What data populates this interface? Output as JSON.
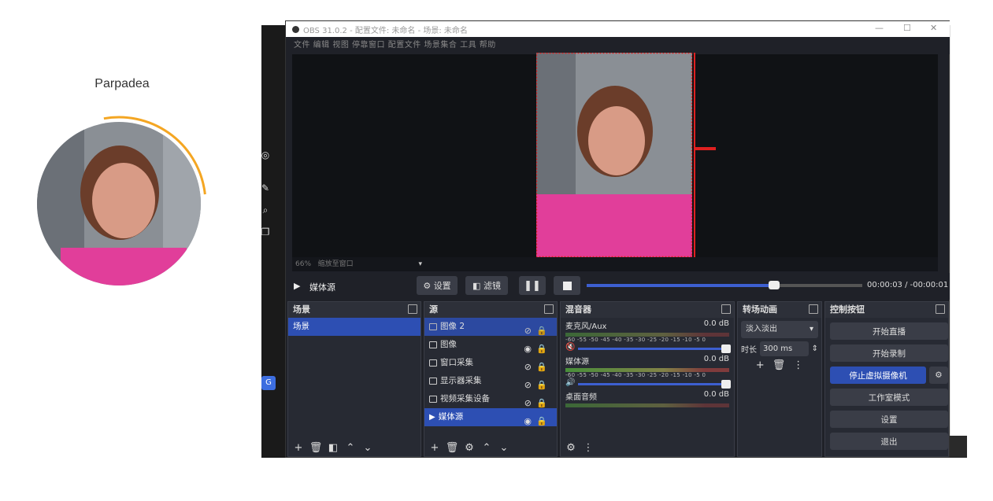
{
  "profile": {
    "name": "Parpadea"
  },
  "obs": {
    "title": "OBS 31.0.2 - 配置文件: 未命名 - 场景: 未命名",
    "menu": "文件  编辑  视图  停靠窗口  配置文件  场景集合  工具  帮助",
    "zoom": "66%",
    "zoom_label": "缩放至窗口",
    "source_name": "媒体源",
    "settings_btn": "设置",
    "filter_btn": "滤镜",
    "time_current": "00:00:03",
    "time_separator": "/",
    "time_remaining": "-00:00:01",
    "progress": 0.68
  },
  "scenes": {
    "header": "场景",
    "items": [
      {
        "label": "场景",
        "selected": true
      }
    ]
  },
  "sources": {
    "header": "源",
    "items": [
      {
        "label": "图像 2",
        "visible": false,
        "selected": true
      },
      {
        "label": "图像",
        "visible": true,
        "selected": false
      },
      {
        "label": "窗口采集",
        "visible": false,
        "selected": false
      },
      {
        "label": "显示器采集",
        "visible": false,
        "selected": false
      },
      {
        "label": "视频采集设备",
        "visible": false,
        "selected": false
      },
      {
        "label": "媒体源",
        "visible": true,
        "selected": true
      }
    ]
  },
  "mixer": {
    "header": "混音器",
    "scale": "-60 -55 -50 -45 -40 -35 -30 -25 -20 -15 -10 -5  0",
    "tracks": [
      {
        "name": "麦克风/Aux",
        "db": "0.0 dB",
        "muted": true
      },
      {
        "name": "媒体源",
        "db": "0.0 dB",
        "muted": false
      },
      {
        "name": "桌面音频",
        "db": "0.0 dB",
        "muted": false
      }
    ]
  },
  "transitions": {
    "header": "转场动画",
    "selected": "淡入淡出",
    "duration_label": "时长",
    "duration_value": "300 ms"
  },
  "controls": {
    "header": "控制按钮",
    "start_stream": "开始直播",
    "start_record": "开始录制",
    "stop_virtual_cam": "停止虚拟摄像机",
    "studio_mode": "工作室模式",
    "settings": "设置",
    "exit": "退出"
  },
  "colors": {
    "accent": "#2d4fb3",
    "bg": "#1f2128",
    "panel": "#272a33"
  }
}
